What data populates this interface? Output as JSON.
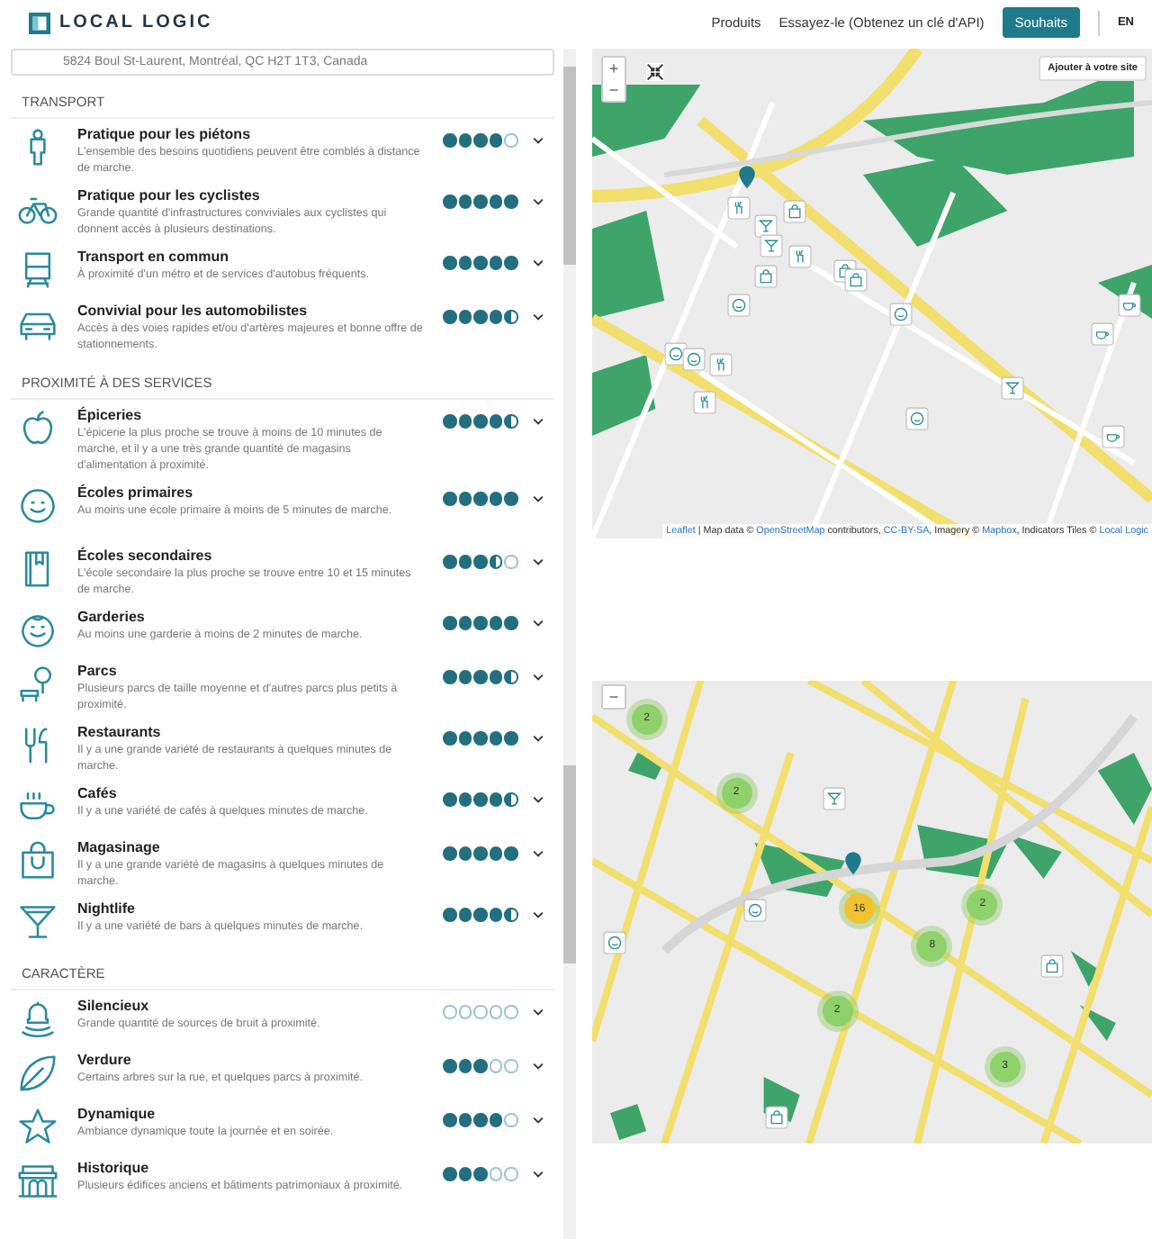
{
  "header": {
    "brand": "LOCAL LOGIC",
    "nav": [
      "Produits",
      "Essayez-le (Obtenez un clé d'API)"
    ],
    "cta": "Souhaits",
    "language": "EN"
  },
  "top_view": {
    "address": "5824 Boul St-Laurent, Montréal, QC H2T 1T3, Canada",
    "sections": [
      {
        "heading": "TRANSPORT",
        "items": [
          {
            "kind": "pedestrian",
            "title": "Pratique pour les piétons",
            "description": "L'ensemble des besoins quotidiens peuvent être comblés à distance de marche.",
            "stars": 4
          },
          {
            "kind": "bicycle",
            "title": "Pratique pour les cyclistes",
            "description": "Grande quantité d'infrastructures conviviales aux cyclistes qui donnent accès à plusieurs destinations.",
            "stars": 5
          },
          {
            "kind": "transit",
            "title": "Transport en commun",
            "description": "À proximité d'un métro et de services d'autobus fréquents.",
            "stars": 5
          },
          {
            "kind": "car",
            "title": "Convivial pour les automobilistes",
            "description": "Accès à des voies rapides et/ou d'artères majeures et bonne offre de stationnements.",
            "stars": 4.5
          }
        ]
      },
      {
        "heading": "PROXIMITÉ À DES SERVICES",
        "items": [
          {
            "kind": "grocery",
            "title": "Épiceries",
            "description": "L'épicerie la plus proche se trouve à moins de 10 minutes de marche, et il y a une très grande quantité de magasins d'alimentation à proximité.",
            "stars": 4.5
          },
          {
            "kind": "school",
            "title": "Écoles primaires",
            "description": "Au moins une école primaire à moins de 5 minutes de marche.",
            "stars": 5
          }
        ]
      }
    ]
  },
  "top_map": {
    "zoom_in": "+",
    "zoom_out": "−",
    "add_button": "Ajouter à votre site",
    "attribution": [
      {
        "text": "Leaflet",
        "link": true
      },
      {
        "text": " | Map data © ",
        "link": false
      },
      {
        "text": "OpenStreetMap",
        "link": true
      },
      {
        "text": " contributors, ",
        "link": false
      },
      {
        "text": "CC-BY-SA",
        "link": true
      },
      {
        "text": ", Imagery © ",
        "link": false
      },
      {
        "text": "Mapbox",
        "link": true
      },
      {
        "text": ", Indicators Tiles © ",
        "link": false
      },
      {
        "text": "Local Logic",
        "link": true
      }
    ]
  },
  "bottom_view": {
    "sections": [
      {
        "items": [
          {
            "kind": "highschool",
            "title": "Écoles secondaires",
            "description": "L'école secondaire la plus proche se trouve entre 10 et 15 minutes de marche.",
            "stars": 3.5
          },
          {
            "kind": "daycare",
            "title": "Garderies",
            "description": "Au moins une garderie à moins de 2 minutes de marche.",
            "stars": 5
          },
          {
            "kind": "park",
            "title": "Parcs",
            "description": "Plusieurs parcs de taille moyenne et d'autres parcs plus petits à proximité.",
            "stars": 4.5
          },
          {
            "kind": "restaurant",
            "title": "Restaurants",
            "description": "Il y a une grande variété de restaurants à quelques minutes de marche.",
            "stars": 5
          },
          {
            "kind": "cafe",
            "title": "Cafés",
            "description": "Il y a une variété de cafés à quelques minutes de marche.",
            "stars": 4.5
          },
          {
            "kind": "shopping",
            "title": "Magasinage",
            "description": "Il y a une grande variété de magasins à quelques minutes de marche.",
            "stars": 5
          },
          {
            "kind": "nightlife",
            "title": "Nightlife",
            "description": "Il y a une variété de bars à quelques minutes de marche.",
            "stars": 4.5
          }
        ]
      },
      {
        "heading": "CARACTÈRE",
        "items": [
          {
            "kind": "quiet",
            "title": "Silencieux",
            "description": "Grande quantité de sources de bruit à proximité.",
            "stars": 0
          },
          {
            "kind": "greenery",
            "title": "Verdure",
            "description": "Certains arbres sur la rue, et quelques parcs à proximité.",
            "stars": 3
          },
          {
            "kind": "vibrant",
            "title": "Dynamique",
            "description": "Ambiance dynamique toute la journée et en soirée.",
            "stars": 4
          },
          {
            "kind": "historic",
            "title": "Historique",
            "description": "Plusieurs édifices anciens et bâtiments patrimoniaux à proximité.",
            "stars": 3
          }
        ]
      }
    ]
  },
  "bottom_map": {
    "zoom_out": "−",
    "clusters": [
      {
        "count": "2",
        "color": "#8fd16a"
      },
      {
        "count": "2",
        "color": "#8fd16a"
      },
      {
        "count": "16",
        "color": "#f2c230"
      },
      {
        "count": "2",
        "color": "#8fd16a"
      },
      {
        "count": "8",
        "color": "#8fd16a"
      },
      {
        "count": "2",
        "color": "#8fd16a"
      },
      {
        "count": "3",
        "color": "#8fd16a"
      }
    ]
  }
}
